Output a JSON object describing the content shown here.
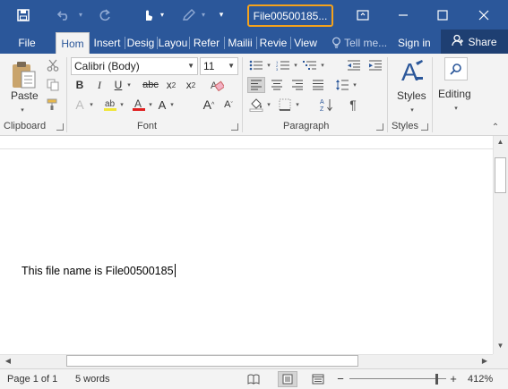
{
  "titlebar": {
    "document_title": "File00500185...",
    "icons": [
      "save-icon",
      "undo-icon",
      "redo-icon",
      "touch-mode-icon",
      "customize-qat-icon",
      "ribbon-display-icon",
      "minimize-icon",
      "maximize-icon",
      "close-icon"
    ],
    "accent_color": "#2b579a",
    "highlight_color": "#f4a21c"
  },
  "tabs": [
    {
      "label": "File"
    },
    {
      "label": "Hom"
    },
    {
      "label": "Insert"
    },
    {
      "label": "Desig"
    },
    {
      "label": "Layou"
    },
    {
      "label": "Refer"
    },
    {
      "label": "Mailii"
    },
    {
      "label": "Revie"
    },
    {
      "label": "View"
    }
  ],
  "tell_me": "Tell me...",
  "sign_in": "Sign in",
  "share": "Share",
  "ribbon": {
    "clipboard": {
      "paste_label": "Paste",
      "group_label": "Clipboard"
    },
    "font": {
      "font_name": "Calibri (Body)",
      "font_size": "11",
      "group_label": "Font",
      "bold": "B",
      "italic": "I",
      "underline": "U",
      "strikethrough": "abc",
      "subscript": "x",
      "superscript": "x",
      "grow": "A",
      "shrink": "A",
      "case": "Aa"
    },
    "paragraph": {
      "group_label": "Paragraph"
    },
    "styles": {
      "label": "Styles",
      "group_label": "Styles"
    },
    "editing": {
      "label": "Editing"
    }
  },
  "document": {
    "text": "This file name is File00500185"
  },
  "statusbar": {
    "page": "Page 1 of 1",
    "words": "5 words",
    "zoom": "412%"
  }
}
